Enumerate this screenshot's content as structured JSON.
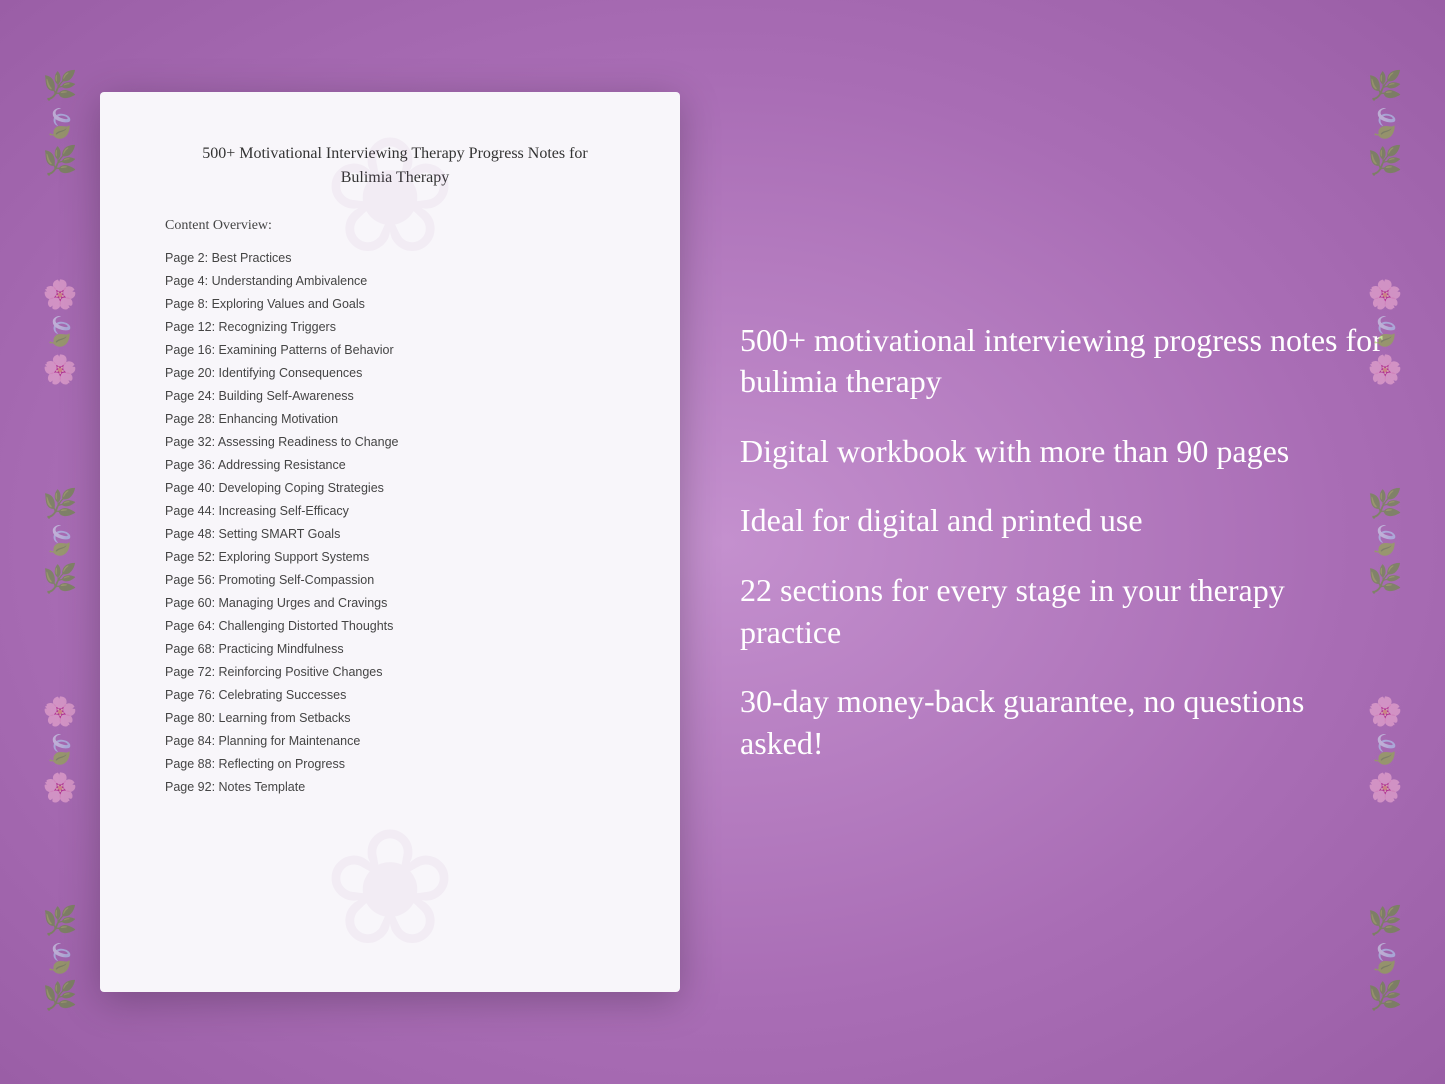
{
  "page": {
    "background_color": "#b87ec0"
  },
  "document": {
    "title_line1": "500+ Motivational Interviewing Therapy Progress Notes for",
    "title_line2": "Bulimia Therapy",
    "content_overview_label": "Content Overview:",
    "toc_items": [
      {
        "page": "Page  2:",
        "topic": "Best Practices"
      },
      {
        "page": "Page  4:",
        "topic": "Understanding Ambivalence"
      },
      {
        "page": "Page  8:",
        "topic": "Exploring Values and Goals"
      },
      {
        "page": "Page 12:",
        "topic": "Recognizing Triggers"
      },
      {
        "page": "Page 16:",
        "topic": "Examining Patterns of Behavior"
      },
      {
        "page": "Page 20:",
        "topic": "Identifying Consequences"
      },
      {
        "page": "Page 24:",
        "topic": "Building Self-Awareness"
      },
      {
        "page": "Page 28:",
        "topic": "Enhancing Motivation"
      },
      {
        "page": "Page 32:",
        "topic": "Assessing Readiness to Change"
      },
      {
        "page": "Page 36:",
        "topic": "Addressing Resistance"
      },
      {
        "page": "Page 40:",
        "topic": "Developing Coping Strategies"
      },
      {
        "page": "Page 44:",
        "topic": "Increasing Self-Efficacy"
      },
      {
        "page": "Page 48:",
        "topic": "Setting SMART Goals"
      },
      {
        "page": "Page 52:",
        "topic": "Exploring Support Systems"
      },
      {
        "page": "Page 56:",
        "topic": "Promoting Self-Compassion"
      },
      {
        "page": "Page 60:",
        "topic": "Managing Urges and Cravings"
      },
      {
        "page": "Page 64:",
        "topic": "Challenging Distorted Thoughts"
      },
      {
        "page": "Page 68:",
        "topic": "Practicing Mindfulness"
      },
      {
        "page": "Page 72:",
        "topic": "Reinforcing Positive Changes"
      },
      {
        "page": "Page 76:",
        "topic": "Celebrating Successes"
      },
      {
        "page": "Page 80:",
        "topic": "Learning from Setbacks"
      },
      {
        "page": "Page 84:",
        "topic": "Planning for Maintenance"
      },
      {
        "page": "Page 88:",
        "topic": "Reflecting on Progress"
      },
      {
        "page": "Page 92:",
        "topic": "Notes Template"
      }
    ]
  },
  "features": [
    "500+ motivational interviewing progress notes for bulimia therapy",
    "Digital workbook with more than 90 pages",
    "Ideal for digital and printed use",
    "22 sections for every stage in your therapy practice",
    "30-day money-back guarantee, no questions asked!"
  ]
}
